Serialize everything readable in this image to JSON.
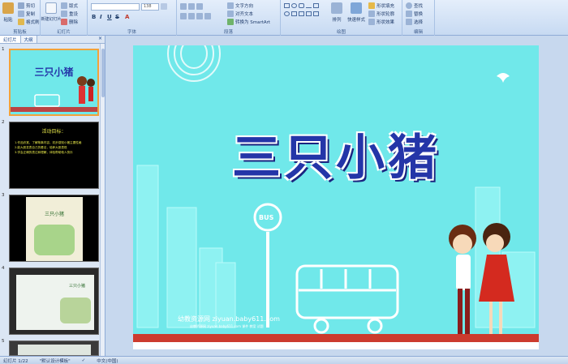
{
  "ribbon": {
    "clipboard": {
      "paste": "粘贴",
      "cut": "剪切",
      "copy": "复制",
      "format_painter": "格式刷",
      "label": "剪贴板"
    },
    "slides": {
      "new_slide": "新建幻灯片",
      "layout": "版式",
      "reset": "重设",
      "delete": "删除",
      "label": "幻灯片"
    },
    "font": {
      "font_name": "",
      "font_size": "138",
      "label": "字体"
    },
    "paragraph": {
      "text_direction": "文字方向",
      "align_text": "对齐文本",
      "smartart": "转换为 SmartArt",
      "label": "段落"
    },
    "drawing": {
      "arrange": "排列",
      "quick_styles": "快速样式",
      "shape_fill": "形状填充",
      "shape_outline": "形状轮廓",
      "shape_effects": "形状效果",
      "label": "绘图"
    },
    "editing": {
      "find": "查找",
      "replace": "替换",
      "select": "选择",
      "label": "编辑"
    }
  },
  "panel": {
    "tab_slides": "幻灯片",
    "tab_outline": "大纲",
    "close": "×",
    "thumbnails": [
      {
        "num": "1",
        "title": "三只小猪"
      },
      {
        "num": "2",
        "title": "活动目标：",
        "lines": [
          "1.作品欣赏，了解故事内容，初步感知小猪主要性格",
          "2.能大胆发表自己的看法，培养大胆表现",
          "3.学会正确的表达和理解，体验帮助他人快乐"
        ]
      },
      {
        "num": "3",
        "title": "三只小猪"
      },
      {
        "num": "4",
        "title": "三只小猪"
      },
      {
        "num": "5",
        "title": ""
      }
    ]
  },
  "slide": {
    "title": "三只小猪",
    "bus_sign": "BUS",
    "watermark": "幼教资源网 ziyuan.baby611.com",
    "watermark_sub": "幼教资源网 ziyuan.baby611.com 课件 教案 试题"
  },
  "status": {
    "slide_counter": "幻灯片 1/22",
    "theme": "\"默认设计模板\"",
    "language": "中文(中国)"
  },
  "colors": {
    "slide_bg": "#70e8ea",
    "title": "#2435a8",
    "selected_border": "#f2a23a"
  }
}
